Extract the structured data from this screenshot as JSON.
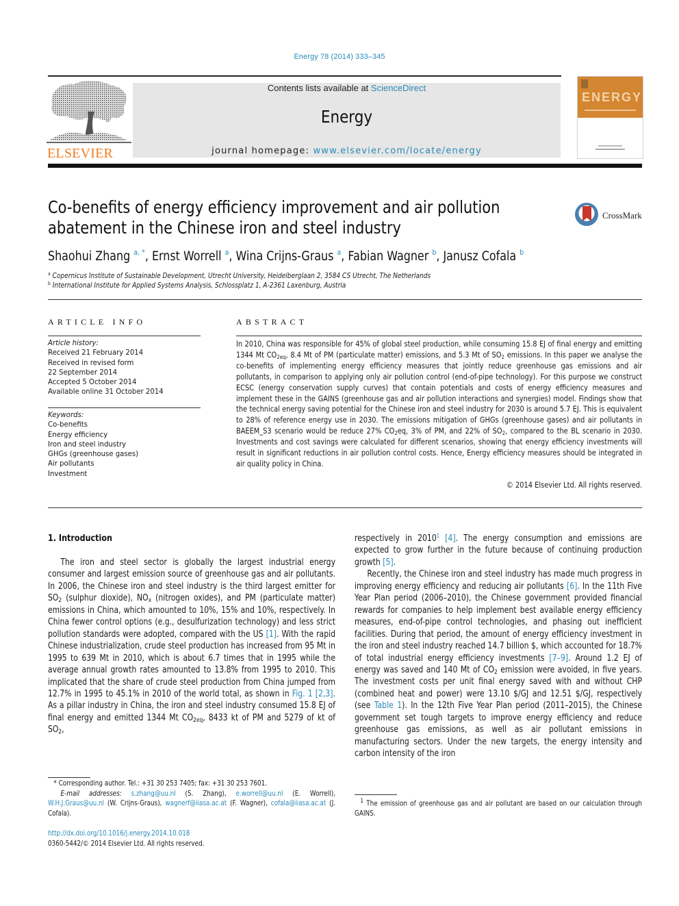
{
  "header": {
    "citation": "Energy 78 (2014) 333–345",
    "contents_prefix": "Contents lists available at ",
    "contents_link": "ScienceDirect",
    "journal_name": "Energy",
    "homepage_prefix": "journal homepage: ",
    "homepage_link": "www.elsevier.com/locate/energy",
    "publisher_logo_text": "ELSEVIER",
    "cover_word": "ENERGY",
    "brand_color": "#f07c1b",
    "link_color": "#2a8ab8",
    "cover_color": "#d48631"
  },
  "article": {
    "title_line1": "Co-benefits of energy efficiency improvement and air pollution",
    "title_line2": "abatement in the Chinese iron and steel industry",
    "crossmark_label": "CrossMark",
    "authors": [
      {
        "name": "Shaohui Zhang",
        "affil": "a, *"
      },
      {
        "name": "Ernst Worrell",
        "affil": "a"
      },
      {
        "name": "Wina Crijns-Graus",
        "affil": "a"
      },
      {
        "name": "Fabian Wagner",
        "affil": "b"
      },
      {
        "name": "Janusz Cofala",
        "affil": "b"
      }
    ],
    "affiliations": [
      {
        "key": "a",
        "text": "Copernicus Institute of Sustainable Development, Utrecht University, Heidelberglaan 2, 3584 CS Utrecht, The Netherlands"
      },
      {
        "key": "b",
        "text": "International Institute for Applied Systems Analysis, Schlossplatz 1, A-2361 Laxenburg, Austria"
      }
    ]
  },
  "article_info": {
    "heading": "ARTICLE INFO",
    "history_label": "Article history:",
    "history": [
      "Received 21 February 2014",
      "Received in revised form",
      "22 September 2014",
      "Accepted 5 October 2014",
      "Available online 31 October 2014"
    ],
    "keywords_label": "Keywords:",
    "keywords": [
      "Co-benefits",
      "Energy efficiency",
      "Iron and steel industry",
      "GHGs (greenhouse gases)",
      "Air pollutants",
      "Investment"
    ]
  },
  "abstract": {
    "heading": "ABSTRACT",
    "s1": "In 2010, China was responsible for 45% of global steel production, while consuming 15.8 EJ of final energy and emitting 1344 Mt CO",
    "s1_sub": "2eq",
    "s2": ", 8.4 Mt of PM (particulate matter) emissions, and 5.3 Mt of SO",
    "s2_sub": "2",
    "s3": " emissions. In this paper we analyse the co-benefits of implementing energy efficiency measures that jointly reduce greenhouse gas emissions and air pollutants, in comparison to applying only air pollution control (end-of-pipe technology). For this purpose we construct ECSC (energy conservation supply curves) that contain potentials and costs of energy efficiency measures and implement these in the GAINS (greenhouse gas and air pollution interactions and synergies) model. Findings show that the technical energy saving potential for the Chinese iron and steel industry for 2030 is around 5.7 EJ. This is equivalent to 28% of reference energy use in 2030. The emissions mitigation of GHGs (greenhouse gases) and air pollutants in BAEEM_S3 scenario would be reduce 27% CO",
    "s3_sub": "2",
    "s4": "eq, 3% of PM, and 22% of SO",
    "s4_sub": "2",
    "s5": ", compared to the BL scenario in 2030. Investments and cost savings were calculated for different scenarios, showing that energy efficiency investments will result in significant reductions in air pollution control costs. Hence, Energy efficiency measures should be integrated in air quality policy in China.",
    "copyright": "© 2014 Elsevier Ltd. All rights reserved."
  },
  "body": {
    "section_title": "1.  Introduction",
    "left": {
      "p1_a": "The iron and steel sector is globally the largest industrial energy consumer and largest emission source of greenhouse gas and air pollutants. In 2006, the Chinese iron and steel industry is the third largest emitter for SO",
      "p1_sub1": "2",
      "p1_b": " (sulphur dioxide), NO",
      "p1_sub2": "x",
      "p1_c": " (nitrogen oxides), and PM (particulate matter) emissions in China, which amounted to 10%, 15% and 10%, respectively. In China fewer control options (e.g., desulfurization technology) and less strict pollution standards were adopted, compared with the US ",
      "ref1": "[1]",
      "p1_d": ". With the rapid Chinese industrialization, crude steel production has increased from 95 Mt in 1995 to 639 Mt in 2010, which is about 6.7 times that in 1995 while the average annual growth rates amounted to 13.8% from 1995 to 2010. This implicated that the share of crude steel production from China jumped from 12.7% in 1995 to 45.1% in 2010 of the world total, as shown in ",
      "fig1": "Fig. 1",
      "ref23": "[2,3]",
      "p1_e": ". As a pillar industry in China, the iron and steel industry consumed 15.8 EJ of final energy and emitted 1344 Mt CO",
      "p1_sub3": "2eq",
      "p1_f": ", 8433 kt of PM and 5279 of kt of SO",
      "p1_sub4": "2",
      "p1_g": ","
    },
    "right": {
      "p1_a": "respectively in 2010",
      "fn_mark": "1",
      "ref4": "[4]",
      "p1_b": ". The energy consumption and emissions are expected to grow further in the future because of continuing production growth ",
      "ref5": "[5]",
      "p1_c": ".",
      "p2_a": "Recently, the Chinese iron and steel industry has made much progress in improving energy efficiency and reducing air pollutants ",
      "ref6": "[6]",
      "p2_b": ". In the 11th Five Year Plan period (2006–2010), the Chinese government provided financial rewards for companies to help implement best available energy efficiency measures, end-of-pipe control technologies, and phasing out inefficient facilities. During that period, the amount of energy efficiency investment in the iron and steel industry reached 14.7 billion $, which accounted for 18.7% of total industrial energy efficiency investments ",
      "ref79": "[7–9]",
      "p2_c": ". Around 1.2 EJ of energy was saved and 140 Mt of CO",
      "p2_sub": "2",
      "p2_d": " emission were avoided, in five years. The investment costs per unit final energy saved with and without CHP (combined heat and power) were 13.10 $/GJ and 12.51 $/GJ, respectively (see ",
      "table1": "Table 1",
      "p2_e": "). In the 12th Five Year Plan period (2011–2015), the Chinese government set tough targets to improve energy efficiency and reduce greenhouse gas emissions, as well as air pollutant emissions in manufacturing sectors. Under the new targets, the energy intensity and carbon intensity of the iron"
    }
  },
  "footnotes": {
    "corresponding": "* Corresponding author. Tel.: +31 30 253 7405; fax: +31 30 253 7601.",
    "email_label": "E-mail addresses: ",
    "emails": [
      {
        "addr": "s.zhang@uu.nl",
        "who": " (S. Zhang), "
      },
      {
        "addr": "e.worrell@uu.nl",
        "who": " (E. Worrell), "
      },
      {
        "addr": "W.H.J.Graus@uu.nl",
        "who": " (W. Crijns-Graus), "
      },
      {
        "addr": "wagnerf@iiasa.ac.at",
        "who": " (F. Wagner), "
      },
      {
        "addr": "cofala@iiasa.ac.at",
        "who": " (J. Cofala)."
      }
    ],
    "doi": "http://dx.doi.org/10.1016/j.energy.2014.10.018",
    "issn_line": "0360-5442/© 2014 Elsevier Ltd. All rights reserved.",
    "fn1_mark": "1",
    "fn1_text": " The emission of greenhouse gas and air pollutant are based on our calculation through GAINS."
  }
}
